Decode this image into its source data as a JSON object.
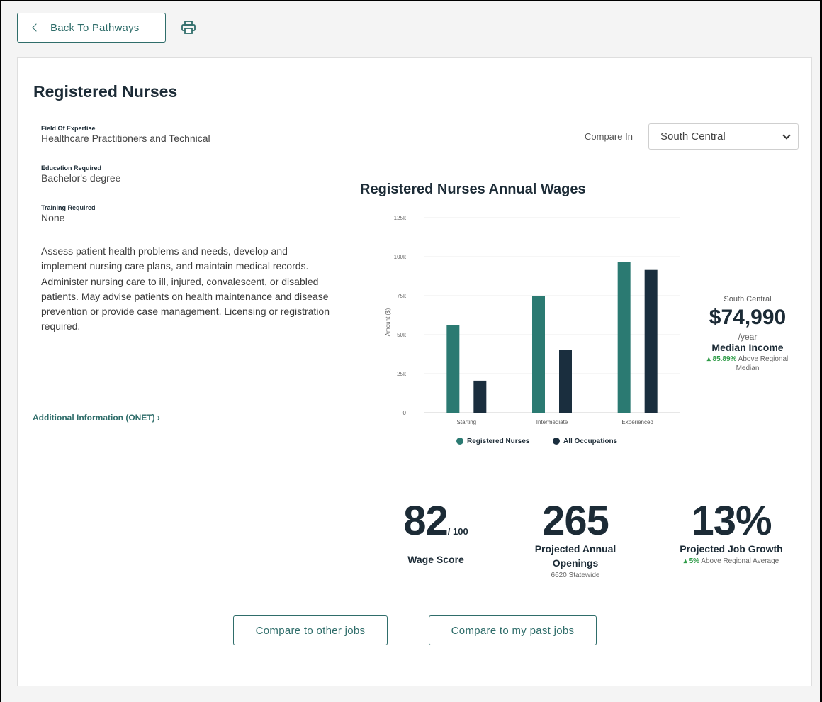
{
  "topbar": {
    "back_label": "Back To Pathways"
  },
  "job": {
    "title": "Registered Nurses",
    "fields": [
      {
        "label": "Field Of Expertise",
        "value": "Healthcare Practitioners and Technical"
      },
      {
        "label": "Education Required",
        "value": "Bachelor's degree"
      },
      {
        "label": "Training Required",
        "value": "None"
      }
    ],
    "description": "Assess patient health problems and needs, develop and implement nursing care plans, and maintain medical records. Administer nursing care to ill, injured, convalescent, or disabled patients. May advise patients on health maintenance and disease prevention or provide case management. Licensing or registration required.",
    "onet_link": "Additional Information (ONET) ›"
  },
  "compare": {
    "label": "Compare In",
    "selected": "South Central"
  },
  "chart_data": {
    "type": "bar",
    "title": "Registered Nurses Annual Wages",
    "ylabel": "Amount ($)",
    "xlabel": "",
    "categories": [
      "Starting",
      "Intermediate",
      "Experienced"
    ],
    "series": [
      {
        "name": "Registered Nurses",
        "values": [
          56000,
          75000,
          96500
        ]
      },
      {
        "name": "All Occupations",
        "values": [
          20500,
          40000,
          91500
        ]
      }
    ],
    "ylim": [
      0,
      125000
    ],
    "yticks": [
      0,
      25000,
      50000,
      75000,
      100000,
      125000
    ],
    "ytick_labels": [
      "0",
      "25k",
      "50k",
      "75k",
      "100k",
      "125k"
    ],
    "grid": true,
    "legend": "bottom",
    "colors": [
      "#2b7a72",
      "#1a2e3e"
    ]
  },
  "median": {
    "region": "South Central",
    "amount": "$74,990",
    "period": "/year",
    "label": "Median Income",
    "pct": "85.89%",
    "comparison": "Above Regional Median"
  },
  "stats": {
    "wage_score": {
      "value": "82",
      "suffix": "/ 100",
      "label": "Wage Score"
    },
    "openings": {
      "value": "265",
      "label": "Projected Annual Openings",
      "sub": "6620 Statewide"
    },
    "growth": {
      "value": "13%",
      "label": "Projected Job Growth",
      "pct": "5%",
      "comparison": "Above Regional Average"
    }
  },
  "buttons": {
    "compare_other": "Compare to other jobs",
    "compare_past": "Compare to my past jobs"
  },
  "colors": {
    "accent": "#2f6d6a",
    "positive": "#2e9b47"
  }
}
